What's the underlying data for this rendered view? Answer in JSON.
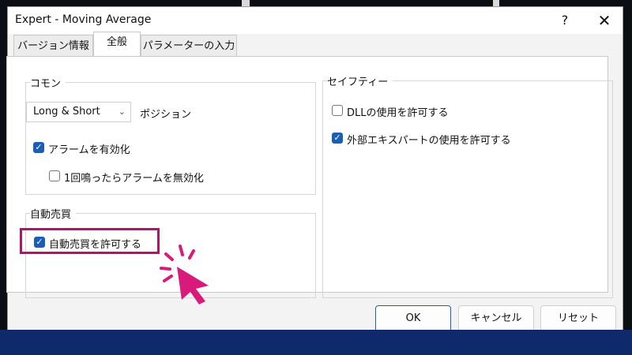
{
  "dialog": {
    "title": "Expert - Moving Average",
    "help": "?",
    "close": "✕"
  },
  "tabs": [
    "バージョン情報",
    "全般",
    "パラメーターの入力"
  ],
  "common": {
    "group_title": "コモン",
    "position_select_value": "Long & Short",
    "position_label": "ポジション",
    "alerts_enabled_label": "アラームを有効化",
    "alerts_enabled_checked": true,
    "disable_after_one_label": "1回鳴ったらアラームを無効化",
    "disable_after_one_checked": false
  },
  "auto_trading": {
    "group_title": "自動売買",
    "allow_label": "自動売買を許可する",
    "allow_checked": true
  },
  "safety": {
    "group_title": "セイフティー",
    "allow_dll_label": "DLLの使用を許可する",
    "allow_dll_checked": false,
    "allow_external_experts_label": "外部エキスパートの使用を許可する",
    "allow_external_experts_checked": true
  },
  "buttons": {
    "ok": "OK",
    "cancel": "キャンセル",
    "reset": "リセット"
  },
  "colors": {
    "checkbox_checked": "#1a5fb4",
    "highlight": "#b5126e",
    "pointer": "#d81b7a",
    "footer": "#0e2a6b"
  },
  "icons": {
    "check": "check-icon",
    "dropdown": "chevron-down-icon",
    "pointer": "hand-pointer-icon"
  }
}
